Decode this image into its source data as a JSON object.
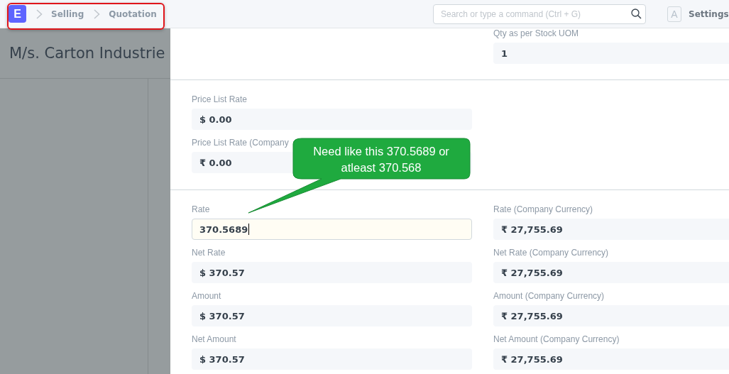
{
  "navbar": {
    "logo": "E",
    "breadcrumbs": [
      "Selling",
      "Quotation"
    ],
    "search": {
      "placeholder": "Search or type a command (Ctrl + G)"
    },
    "avatar": "A",
    "settings": "Settings"
  },
  "backdrop": {
    "title": "M/s. Carton Industrie"
  },
  "sections": [
    {
      "right": [
        {
          "label": "Qty as per Stock UOM",
          "value": "1",
          "kind": "readonly"
        }
      ]
    },
    {
      "left": [
        {
          "label": "Price List Rate",
          "value": "$ 0.00",
          "kind": "readonly"
        },
        {
          "label": "Price List Rate (Company",
          "value": "₹ 0.00",
          "kind": "readonly"
        }
      ]
    },
    {
      "left": [
        {
          "label": "Rate",
          "value": "370.5689",
          "kind": "input"
        },
        {
          "label": "Net Rate",
          "value": "$ 370.57",
          "kind": "readonly"
        },
        {
          "label": "Amount",
          "value": "$ 370.57",
          "kind": "readonly"
        },
        {
          "label": "Net Amount",
          "value": "$ 370.57",
          "kind": "readonly"
        }
      ],
      "right": [
        {
          "label": "Rate (Company Currency)",
          "value": "₹ 27,755.69",
          "kind": "readonly"
        },
        {
          "label": "Net Rate (Company Currency)",
          "value": "₹ 27,755.69",
          "kind": "readonly"
        },
        {
          "label": "Amount (Company Currency)",
          "value": "₹ 27,755.69",
          "kind": "readonly"
        },
        {
          "label": "Net Amount (Company Currency)",
          "value": "₹ 27,755.69",
          "kind": "readonly"
        }
      ]
    }
  ],
  "callout": {
    "text": "Need like this 370.5689 or atleast 370.568"
  }
}
